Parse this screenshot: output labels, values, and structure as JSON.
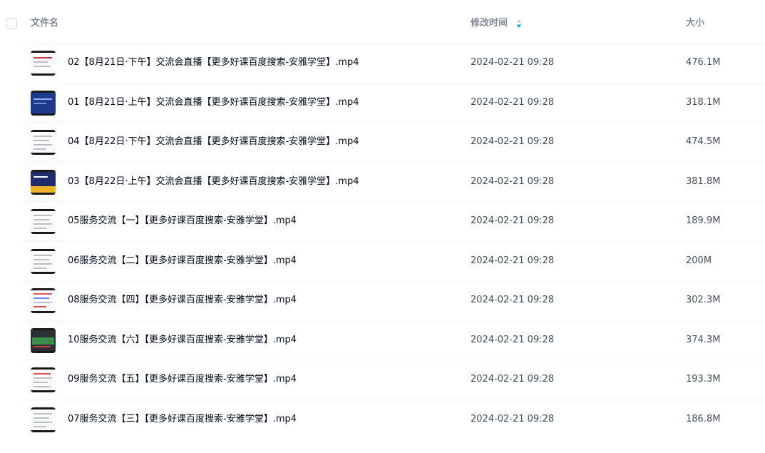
{
  "header": {
    "name_label": "文件名",
    "time_label": "修改时间",
    "size_label": "大小",
    "sort_icon": "sort-desc-icon",
    "accent_color": "#06a7ff"
  },
  "files": [
    {
      "name": "02【8月21日·下午】交流会直播【更多好课百度搜索-安雅学堂】.mp4",
      "modified": "2024-02-21 09:28",
      "size": "476.1M",
      "thumb_style": "slide-red"
    },
    {
      "name": "01【8月21日·上午】交流会直播【更多好课百度搜索-安雅学堂】.mp4",
      "modified": "2024-02-21 09:28",
      "size": "318.1M",
      "thumb_style": "slide-blue"
    },
    {
      "name": "04【8月22日·下午】交流会直播【更多好课百度搜索-安雅学堂】.mp4",
      "modified": "2024-02-21 09:28",
      "size": "474.5M",
      "thumb_style": "doc"
    },
    {
      "name": "03【8月22日·上午】交流会直播【更多好课百度搜索-安雅学堂】.mp4",
      "modified": "2024-02-21 09:28",
      "size": "381.8M",
      "thumb_style": "slide-navy"
    },
    {
      "name": "05服务交流【一】【更多好课百度搜索-安雅学堂】.mp4",
      "modified": "2024-02-21 09:28",
      "size": "189.9M",
      "thumb_style": "doc-plain"
    },
    {
      "name": "06服务交流【二】【更多好课百度搜索-安雅学堂】.mp4",
      "modified": "2024-02-21 09:28",
      "size": "200M",
      "thumb_style": "doc"
    },
    {
      "name": "08服务交流【四】【更多好课百度搜索-安雅学堂】.mp4",
      "modified": "2024-02-21 09:28",
      "size": "302.3M",
      "thumb_style": "doc-color"
    },
    {
      "name": "10服务交流【六】【更多好课百度搜索-安雅学堂】.mp4",
      "modified": "2024-02-21 09:28",
      "size": "374.3M",
      "thumb_style": "dark-chart"
    },
    {
      "name": "09服务交流【五】【更多好课百度搜索-安雅学堂】.mp4",
      "modified": "2024-02-21 09:28",
      "size": "193.3M",
      "thumb_style": "doc-red"
    },
    {
      "name": "07服务交流【三】【更多好课百度搜索-安雅学堂】.mp4",
      "modified": "2024-02-21 09:28",
      "size": "186.8M",
      "thumb_style": "doc"
    }
  ]
}
